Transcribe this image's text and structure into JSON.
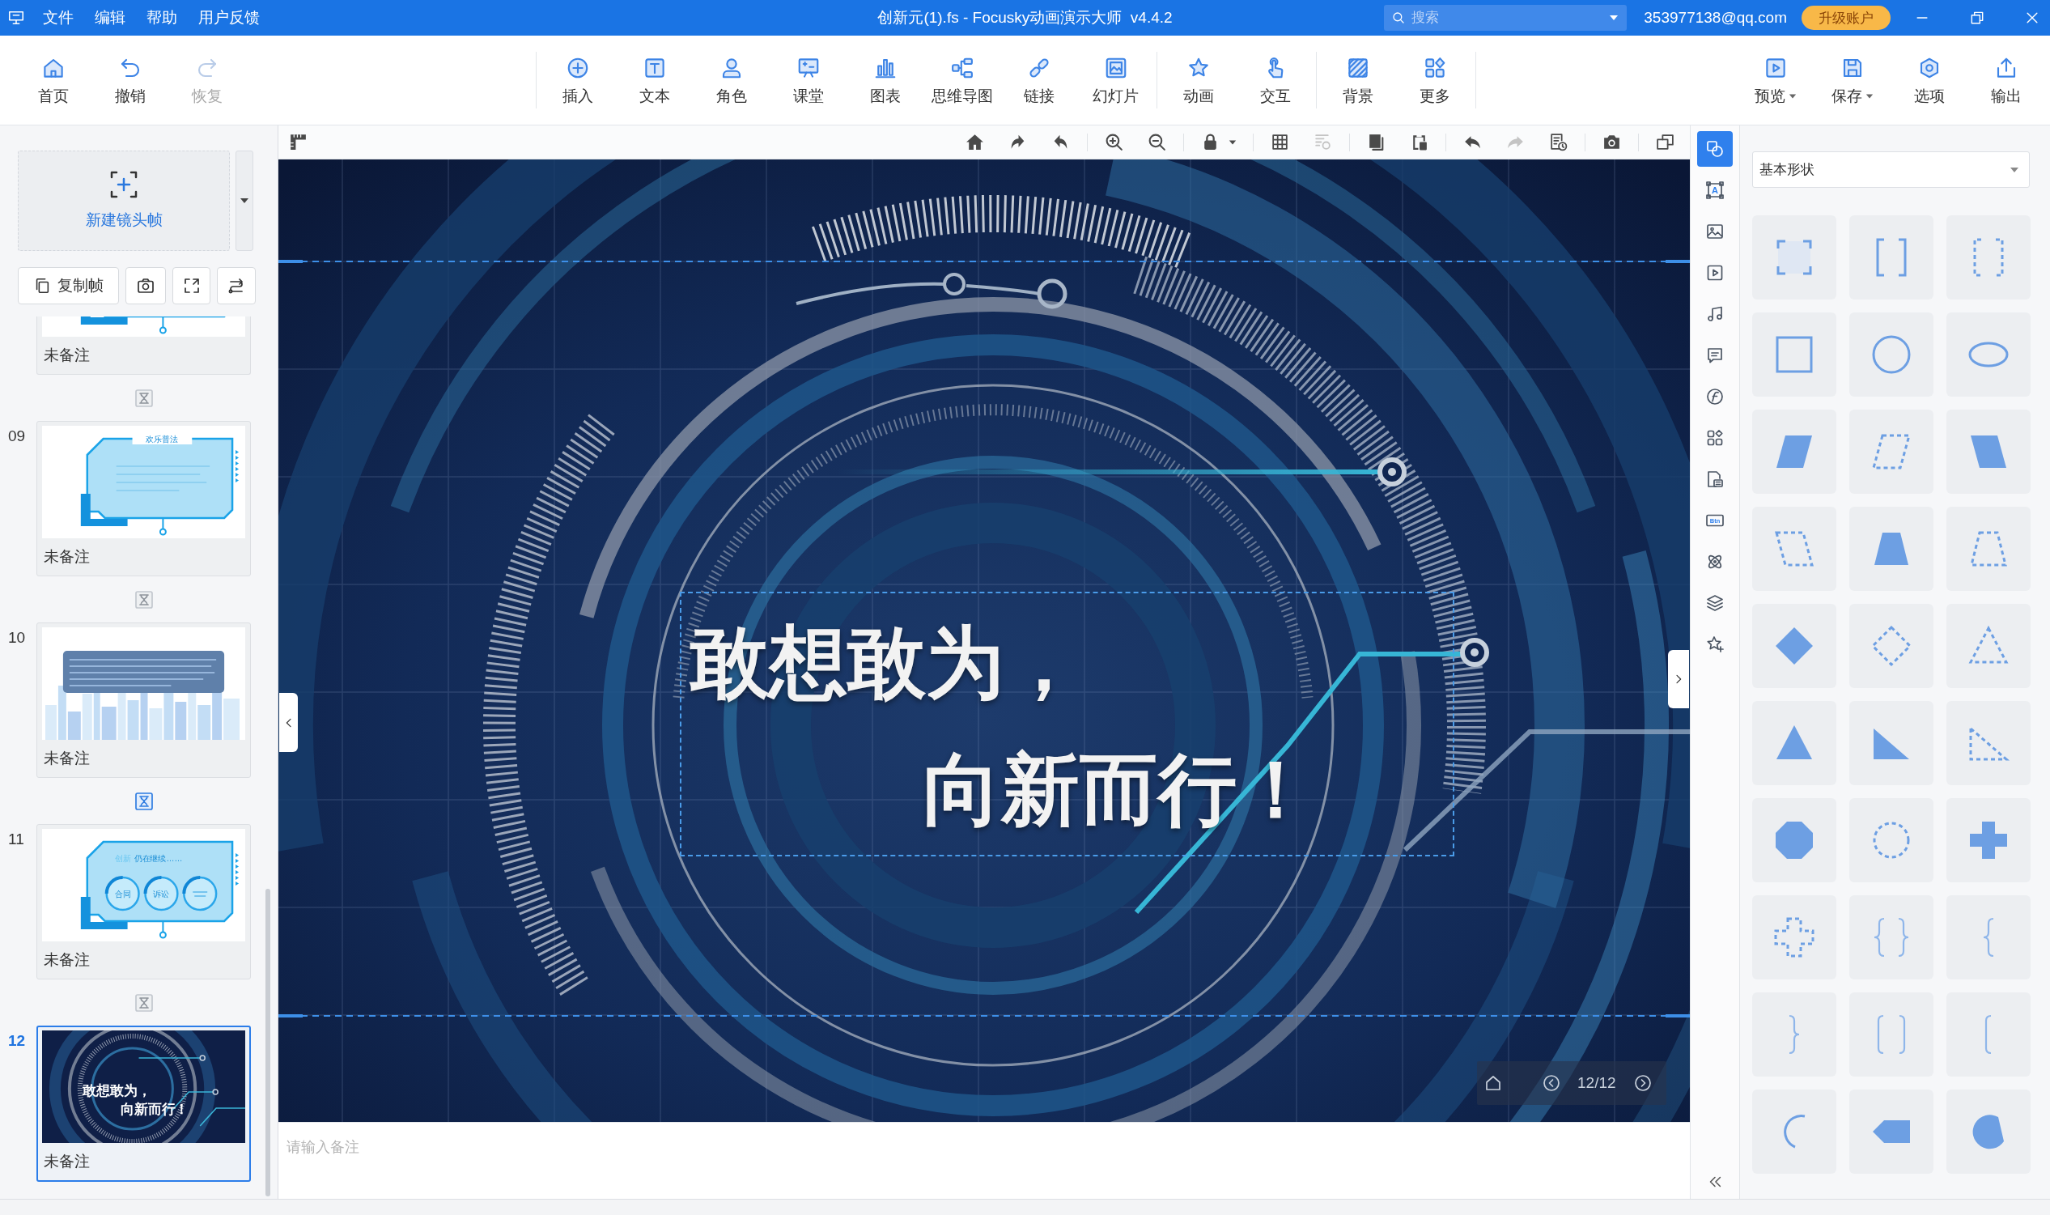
{
  "window": {
    "title": "创新元(1).fs - Focusky动画演示大师  v4.4.2",
    "menus": [
      "文件",
      "编辑",
      "帮助",
      "用户反馈"
    ],
    "search": {
      "placeholder": "搜索"
    },
    "account": "353977138@qq.com",
    "upgrade_button": "升级账户"
  },
  "toolbar": {
    "groups": [
      {
        "items": [
          {
            "kind": "home",
            "label": "首页",
            "disabled": false,
            "dropdown": false
          },
          {
            "kind": "undo",
            "label": "撤销",
            "disabled": false,
            "dropdown": false
          },
          {
            "kind": "redo",
            "label": "恢复",
            "disabled": true,
            "dropdown": false
          }
        ]
      },
      {
        "items": [
          {
            "kind": "insert",
            "label": "插入",
            "disabled": false,
            "dropdown": false
          },
          {
            "kind": "text",
            "label": "文本",
            "disabled": false,
            "dropdown": false
          },
          {
            "kind": "character",
            "label": "角色",
            "disabled": false,
            "dropdown": false
          },
          {
            "kind": "classroom",
            "label": "课堂",
            "disabled": false,
            "dropdown": false
          },
          {
            "kind": "chart",
            "label": "图表",
            "disabled": false,
            "dropdown": false
          },
          {
            "kind": "mindmap",
            "label": "思维导图",
            "disabled": false,
            "dropdown": false
          },
          {
            "kind": "link",
            "label": "链接",
            "disabled": false,
            "dropdown": false
          },
          {
            "kind": "slides",
            "label": "幻灯片",
            "disabled": false,
            "dropdown": false
          }
        ]
      },
      {
        "items": [
          {
            "kind": "animation",
            "label": "动画",
            "disabled": false,
            "dropdown": false
          },
          {
            "kind": "interaction",
            "label": "交互",
            "disabled": false,
            "dropdown": false
          }
        ]
      },
      {
        "items": [
          {
            "kind": "background",
            "label": "背景",
            "disabled": false,
            "dropdown": false
          },
          {
            "kind": "more",
            "label": "更多",
            "disabled": false,
            "dropdown": false
          }
        ]
      }
    ],
    "end_items": [
      {
        "kind": "preview",
        "label": "预览",
        "disabled": false,
        "dropdown": true
      },
      {
        "kind": "save",
        "label": "保存",
        "disabled": false,
        "dropdown": true
      },
      {
        "kind": "options",
        "label": "选项",
        "disabled": false,
        "dropdown": false
      },
      {
        "kind": "export",
        "label": "输出",
        "disabled": false,
        "dropdown": false
      }
    ]
  },
  "frame_panel": {
    "new_frame_button": "新建镜头帧",
    "copy_button": "复制帧",
    "frames": [
      {
        "kind": "blue-frame",
        "cropped": true,
        "note": "未备注",
        "selected": false,
        "transition": {
          "highlighted": false
        }
      },
      {
        "number": "09",
        "kind": "blue-frame",
        "cropped": false,
        "title": "欢乐普法",
        "note": "未备注",
        "selected": false,
        "transition": {
          "highlighted": false
        }
      },
      {
        "number": "10",
        "kind": "skyline",
        "cropped": false,
        "note": "未备注",
        "selected": false,
        "transition": {
          "highlighted": true
        }
      },
      {
        "number": "11",
        "kind": "circles-panel",
        "cropped": false,
        "title": "创新",
        "subtitle": "仍在继续……",
        "circles": [
          "合同",
          "诉讼"
        ],
        "note": "未备注",
        "selected": false,
        "transition": {
          "highlighted": false
        }
      },
      {
        "number": "12",
        "kind": "tech-circles",
        "cropped": false,
        "lines": [
          "敢想敢为，",
          "向新而行！"
        ],
        "note": "未备注",
        "selected": true
      }
    ]
  },
  "canvas": {
    "toolbar": {
      "start": [
        {
          "kind": "ruler",
          "disabled": false
        }
      ],
      "groups": [
        [
          {
            "kind": "home",
            "disabled": false
          },
          {
            "kind": "rotate-right",
            "disabled": false
          },
          {
            "kind": "rotate-left",
            "disabled": false
          }
        ],
        [
          {
            "kind": "zoom-in",
            "disabled": false
          },
          {
            "kind": "zoom-out",
            "disabled": false
          }
        ],
        [
          {
            "kind": "lock",
            "disabled": false
          },
          {
            "kind": "lock-menu",
            "disabled": false
          }
        ],
        [
          {
            "kind": "grid",
            "disabled": false
          },
          {
            "kind": "align",
            "disabled": true
          }
        ],
        [
          {
            "kind": "copy",
            "disabled": false
          },
          {
            "kind": "paste",
            "disabled": false
          }
        ],
        [
          {
            "kind": "undo",
            "disabled": false
          },
          {
            "kind": "redo",
            "disabled": true
          },
          {
            "kind": "history",
            "disabled": false
          }
        ],
        [
          {
            "kind": "camera",
            "disabled": false
          }
        ],
        [
          {
            "kind": "window",
            "disabled": false
          }
        ]
      ]
    },
    "text_box": {
      "selected": true,
      "lines": [
        "敢想敢为，",
        "向新而行！"
      ]
    },
    "page_counter": "12/12",
    "notes": {
      "placeholder": "请输入备注"
    }
  },
  "tool_strip": {
    "tools": [
      {
        "kind": "shapes",
        "selected": true
      },
      {
        "kind": "text",
        "label": "A",
        "selected": false
      },
      {
        "kind": "image",
        "selected": false
      },
      {
        "kind": "video",
        "selected": false
      },
      {
        "kind": "audio",
        "selected": false
      },
      {
        "kind": "note",
        "selected": false
      },
      {
        "kind": "function",
        "selected": false
      },
      {
        "kind": "widgets",
        "selected": false
      },
      {
        "kind": "document",
        "selected": false
      },
      {
        "kind": "button",
        "label": "Btn",
        "selected": false
      },
      {
        "kind": "atom",
        "selected": false
      },
      {
        "kind": "layers",
        "selected": false
      },
      {
        "kind": "favorite",
        "selected": false
      }
    ]
  },
  "shape_panel": {
    "category": "基本形状",
    "shapes": [
      {
        "kind": "corner-frame"
      },
      {
        "kind": "bracket-pair"
      },
      {
        "kind": "dashed-bracket-pair"
      },
      {
        "kind": "square"
      },
      {
        "kind": "circle"
      },
      {
        "kind": "ellipse"
      },
      {
        "kind": "parallelogram"
      },
      {
        "kind": "dashed-parallelogram"
      },
      {
        "kind": "slanted-parallelogram"
      },
      {
        "kind": "dashed-slanted-parallelogram"
      },
      {
        "kind": "trapezoid"
      },
      {
        "kind": "dashed-trapezoid"
      },
      {
        "kind": "diamond"
      },
      {
        "kind": "dashed-diamond"
      },
      {
        "kind": "dashed-triangle"
      },
      {
        "kind": "triangle"
      },
      {
        "kind": "right-triangle"
      },
      {
        "kind": "dashed-right-triangle"
      },
      {
        "kind": "octagon"
      },
      {
        "kind": "dashed-circle"
      },
      {
        "kind": "cross"
      },
      {
        "kind": "dashed-cross"
      },
      {
        "kind": "brace-pair"
      },
      {
        "kind": "left-brace"
      },
      {
        "kind": "right-brace"
      },
      {
        "kind": "paren-pair"
      },
      {
        "kind": "left-paren"
      },
      {
        "kind": "arc"
      },
      {
        "kind": "arrow-tag"
      },
      {
        "kind": "chord"
      }
    ]
  }
}
